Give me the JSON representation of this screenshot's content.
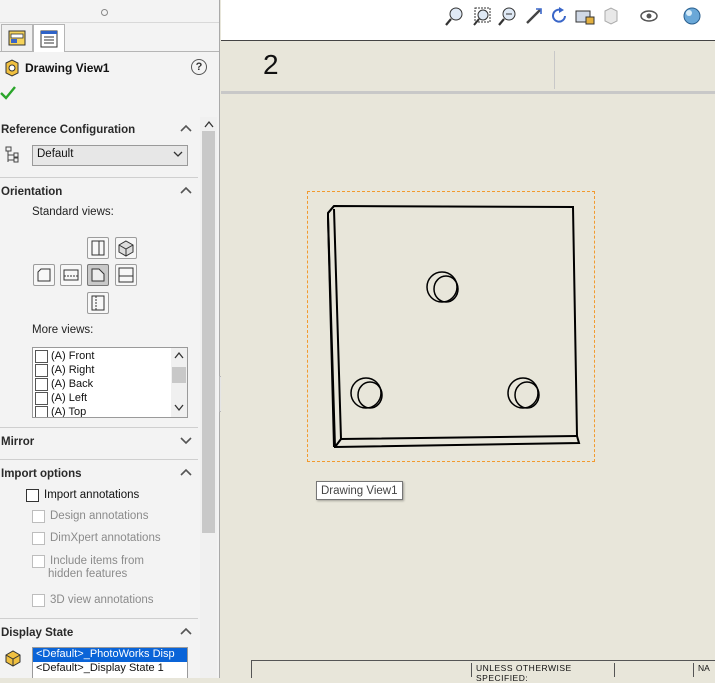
{
  "property_manager": {
    "title": "Drawing View1",
    "help_label": "?",
    "sections": {
      "reference_configuration": {
        "title": "Reference Configuration",
        "value": "Default"
      },
      "orientation": {
        "title": "Orientation",
        "standard_views_label": "Standard views:",
        "more_views_label": "More views:",
        "more_views": [
          "(A) Front",
          "(A) Right",
          "(A) Back",
          "(A) Left",
          "(A) Top"
        ]
      },
      "mirror": {
        "title": "Mirror"
      },
      "import_options": {
        "title": "Import options",
        "import_annotations": "Import annotations",
        "design_annotations": "Design annotations",
        "dimxpert_annotations": "DimXpert annotations",
        "include_items_line1": "Include items from",
        "include_items_line2": "hidden features",
        "view_3d_annotations": "3D view annotations"
      },
      "display_state": {
        "title": "Display State",
        "items": [
          "<Default>_PhotoWorks Disp",
          "<Default>_Display State 1"
        ]
      }
    }
  },
  "sheet": {
    "number": "2",
    "view_tooltip": "Drawing View1",
    "title_block_text": "UNLESS OTHERWISE SPECIFIED:",
    "title_block_right": "NA"
  },
  "colors": {
    "selection_frame": "#f29a2e",
    "list_selection": "#0a64d8",
    "ok_check": "#2aa52a"
  }
}
